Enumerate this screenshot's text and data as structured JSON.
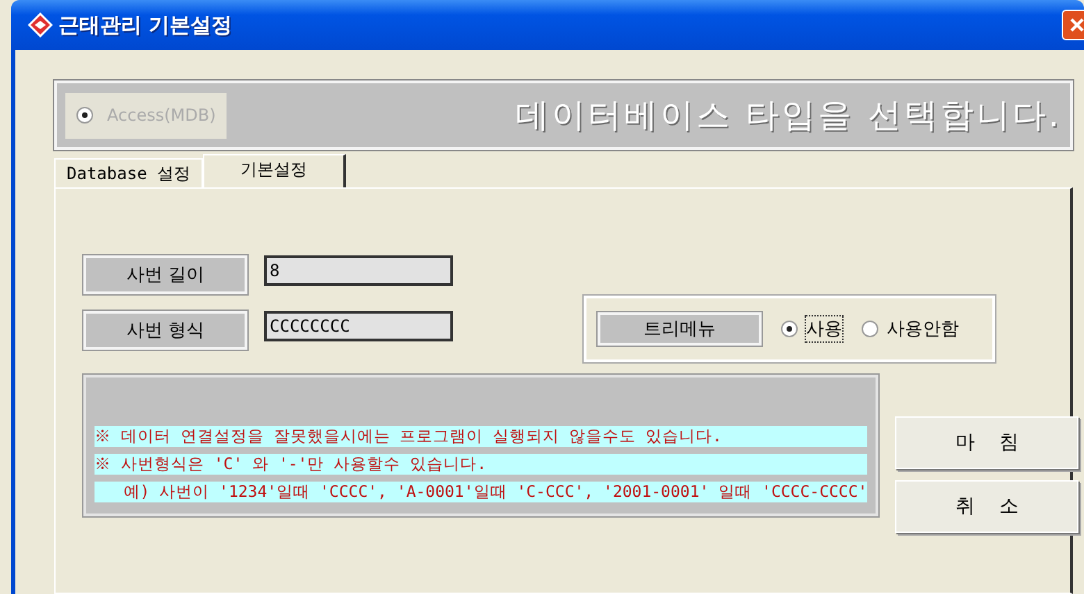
{
  "window": {
    "title": "근태관리 기본설정"
  },
  "database_banner": {
    "option": {
      "label": "Access(MDB)",
      "selected": true,
      "disabled": true
    },
    "caption": "데이터베이스 타입을 선택합니다."
  },
  "tabs": [
    {
      "label": "Database 설정",
      "selected": false
    },
    {
      "label": "기본설정",
      "selected": true
    }
  ],
  "fields": [
    {
      "label": "사번 길이",
      "value": "8"
    },
    {
      "label": "사번 형식",
      "value": "CCCCCCCC"
    }
  ],
  "tree_menu": {
    "label": "트리메뉴",
    "options": [
      {
        "label": "사용",
        "selected": true
      },
      {
        "label": "사용안함",
        "selected": false
      }
    ]
  },
  "notes": [
    "※ 데이터 연결설정을 잘못했을시에는 프로그램이 실행되지 않을수도 있습니다.",
    "※ 사번형식은 'C' 와 '-'만 사용할수 있습니다.",
    "   예) 사번이 '1234'일때 'CCCC', 'A-0001'일때 'C-CCC', '2001-0001' 일때 'CCCC-CCCC'"
  ],
  "buttons": [
    "마    침",
    "취    소"
  ]
}
